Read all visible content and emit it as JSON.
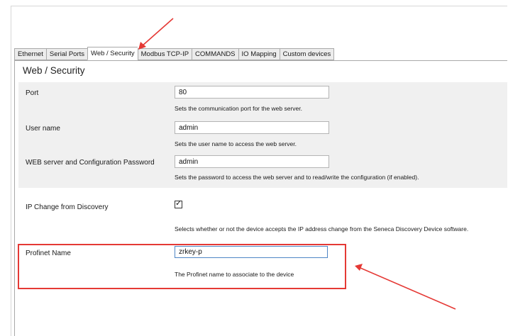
{
  "tabs": [
    {
      "label": "Ethernet",
      "active": false
    },
    {
      "label": "Serial Ports",
      "active": false
    },
    {
      "label": "Web / Security",
      "active": true
    },
    {
      "label": "Modbus TCP-IP",
      "active": false
    },
    {
      "label": "COMMANDS",
      "active": false
    },
    {
      "label": "IO Mapping",
      "active": false
    },
    {
      "label": "Custom devices",
      "active": false
    }
  ],
  "panel": {
    "title": "Web / Security"
  },
  "settings": {
    "port": {
      "label": "Port",
      "value": "80",
      "description": "Sets the communication port for the web server."
    },
    "username": {
      "label": "User name",
      "value": "admin",
      "description": "Sets the user name to access the web server."
    },
    "password": {
      "label": "WEB server and Configuration Password",
      "value": "admin",
      "description": "Sets the password to access the web server and to read/write the configuration (if enabled)."
    },
    "ip_change": {
      "label": "IP Change from Discovery",
      "checked": true,
      "check_glyph": "✓",
      "description": "Selects whether or not the device accepts the IP address change from the Seneca Discovery Device software."
    },
    "profinet": {
      "label": "Profinet Name",
      "value": "zrkey-p",
      "description": "The Profinet name to associate to the device"
    }
  },
  "annotation_color": "#e53935"
}
